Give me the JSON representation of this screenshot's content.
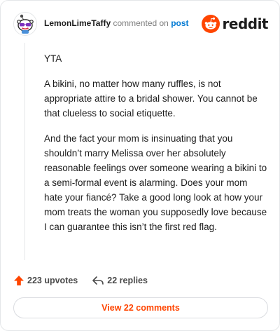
{
  "comment": {
    "author": "LemonLimeTaffy",
    "meta_text": "commented on",
    "post_link_label": "post",
    "paragraphs": [
      "YTA",
      "A bikini, no matter how many ruffles, is not appropriate attire to a bridal shower. You cannot be that clueless to social etiquette.",
      "And the fact your mom is insinuating that you shouldn’t marry Melissa over her absolutely reasonable feelings over someone wearing a bikini to a semi-formal event is alarming. Does your mom hate your fiancé? Take a good long look at how your mom treats the woman you supposedly love because I can guarantee this isn’t the first red flag."
    ]
  },
  "brand": {
    "wordmark": "reddit",
    "icon": "reddit-snoo-icon",
    "color": "#ff4500"
  },
  "stats": {
    "upvotes_label": "223 upvotes",
    "replies_label": "22 replies",
    "upvote_icon": "upvote-arrow-icon",
    "reply_icon": "reply-arrow-icon",
    "upvote_color": "#ff4500"
  },
  "actions": {
    "view_comments_label": "View 22 comments"
  }
}
